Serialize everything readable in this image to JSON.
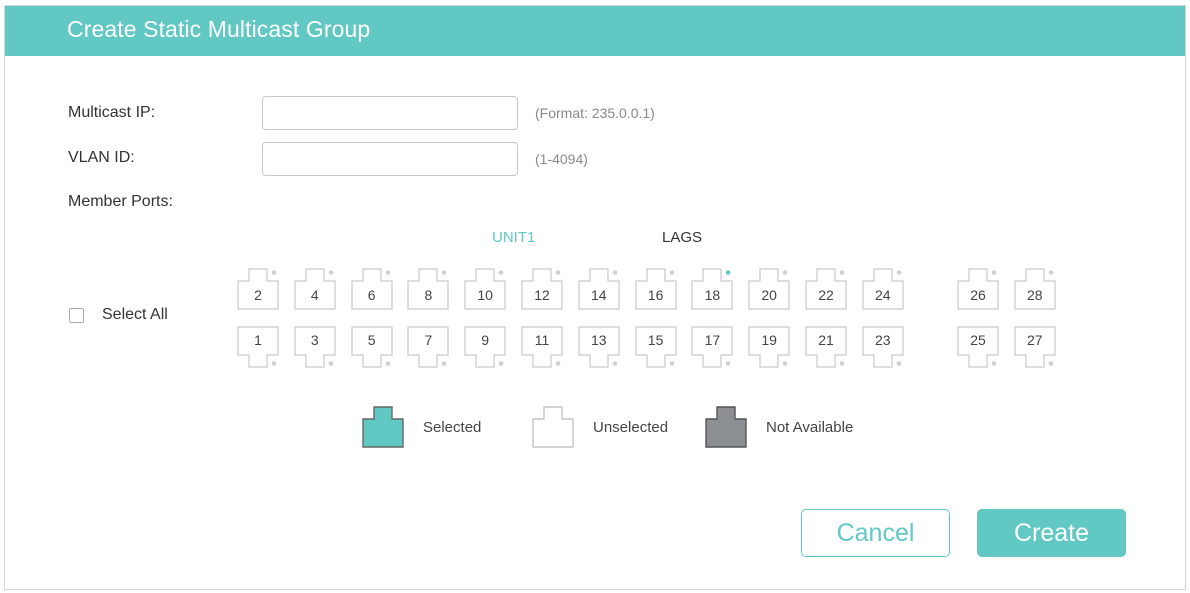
{
  "dialog": {
    "title": "Create Static Multicast Group"
  },
  "form": {
    "multicast_ip": {
      "label": "Multicast IP:",
      "value": "",
      "hint": "(Format: 235.0.0.1)"
    },
    "vlan_id": {
      "label": "VLAN ID:",
      "value": "",
      "hint": "(1-4094)"
    },
    "member_ports_label": "Member Ports:"
  },
  "ports": {
    "unit_label": "UNIT1",
    "lags_label": "LAGS",
    "select_all_label": "Select All",
    "unit_top": [
      "2",
      "4",
      "6",
      "8",
      "10",
      "12",
      "14",
      "16",
      "18",
      "20",
      "22",
      "24"
    ],
    "unit_bottom": [
      "1",
      "3",
      "5",
      "7",
      "9",
      "11",
      "13",
      "15",
      "17",
      "19",
      "21",
      "23"
    ],
    "lag_top": [
      "26",
      "28"
    ],
    "lag_bottom": [
      "25",
      "27"
    ],
    "active_indicator_port": "18"
  },
  "legend": {
    "selected": "Selected",
    "unselected": "Unselected",
    "not_available": "Not Available"
  },
  "buttons": {
    "cancel": "Cancel",
    "create": "Create"
  },
  "colors": {
    "accent": "#61c8c4",
    "not_available": "#8c8f94",
    "port_border": "#c9c9c9",
    "indicator_active": "#61c8c4",
    "indicator_idle": "#d0d0d0"
  }
}
